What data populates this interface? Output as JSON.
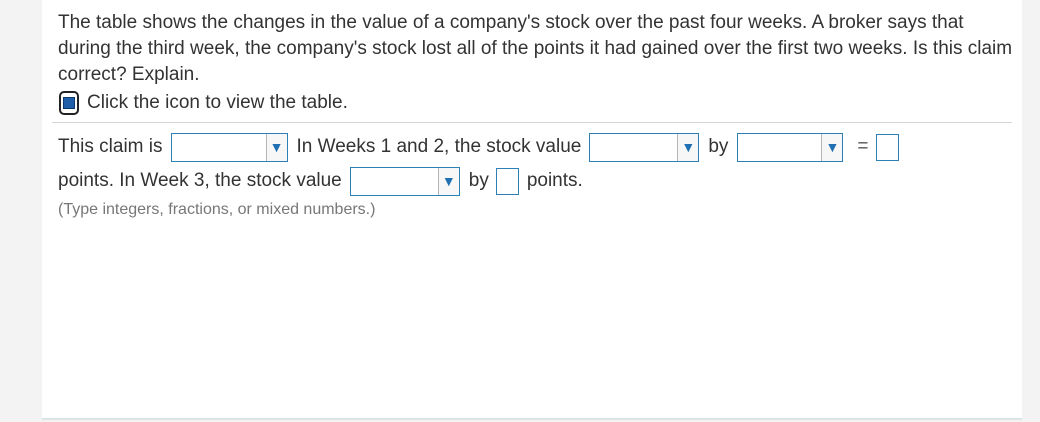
{
  "question": {
    "text": "The table shows the changes in the value of a company's stock over the past four weeks. A broker says that during the third week, the company's stock lost all of the points it had gained over the first two weeks. Is this claim correct? Explain."
  },
  "table_link": {
    "icon": "table-icon",
    "label": "Click the icon to view the table."
  },
  "answer": {
    "line1": {
      "prefix": "This claim is",
      "mid1": "In Weeks 1 and 2, the stock value",
      "by": "by",
      "equals": "="
    },
    "line2": {
      "prefix": "points. In Week 3, the stock value",
      "by": "by",
      "suffix": "points."
    },
    "dropdowns": {
      "claim": "",
      "weeks12_change": "",
      "weeks12_amount": "",
      "week3_change": ""
    },
    "inputs": {
      "weeks12_total": "",
      "week3_amount": ""
    }
  },
  "hint": "(Type integers, fractions, or mixed numbers.)",
  "colors": {
    "accent": "#2d7fb8",
    "arrow": "#1f6fb2",
    "text": "#333333",
    "hint": "#777777"
  }
}
